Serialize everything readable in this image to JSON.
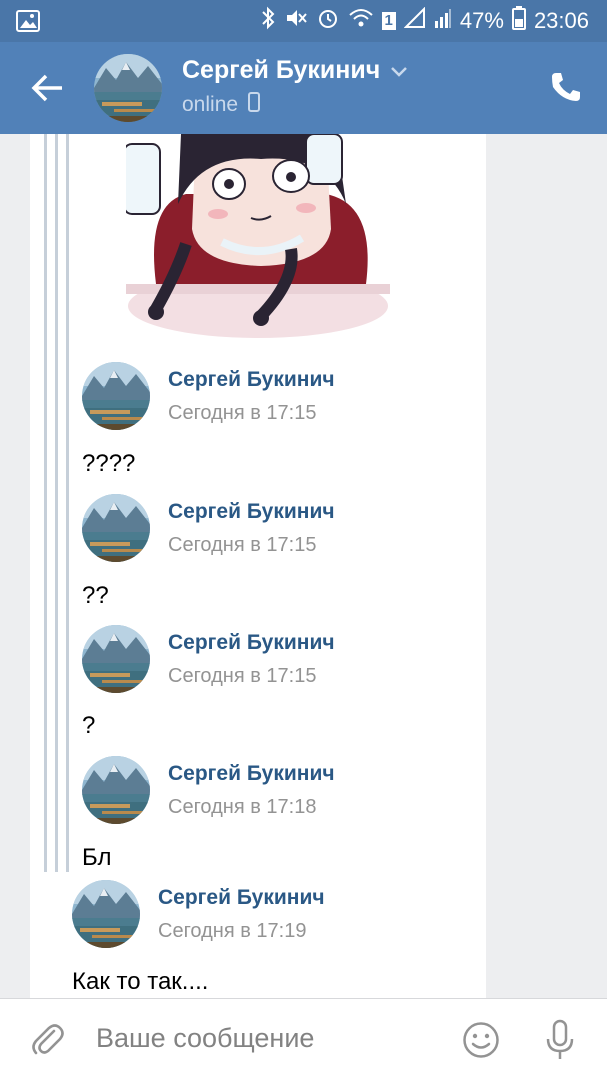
{
  "statusbar": {
    "battery": "47%",
    "time": "23:06",
    "sim": "1"
  },
  "header": {
    "name": "Сергей Букинич",
    "status": "online",
    "icons": [
      "back-arrow-icon",
      "chevron-down-icon",
      "mobile-phone-icon",
      "phone-call-icon"
    ]
  },
  "messages": [
    {
      "author": "Сергей Букинич",
      "time": "Сегодня в 17:15",
      "text": "????"
    },
    {
      "author": "Сергей Букинич",
      "time": "Сегодня в 17:15",
      "text": "??"
    },
    {
      "author": "Сергей Букинич",
      "time": "Сегодня в 17:15",
      "text": "?"
    },
    {
      "author": "Сергей Букинич",
      "time": "Сегодня в 17:18",
      "text": "Бл"
    },
    {
      "author": "Сергей Букинич",
      "time": "Сегодня в 17:19",
      "text": "Как то так...."
    }
  ],
  "input": {
    "placeholder": "Ваше сообщение"
  },
  "colors": {
    "header": "#5181b8",
    "statusbar": "#4a76a8",
    "author": "#2a5885",
    "background": "#edeef0"
  }
}
